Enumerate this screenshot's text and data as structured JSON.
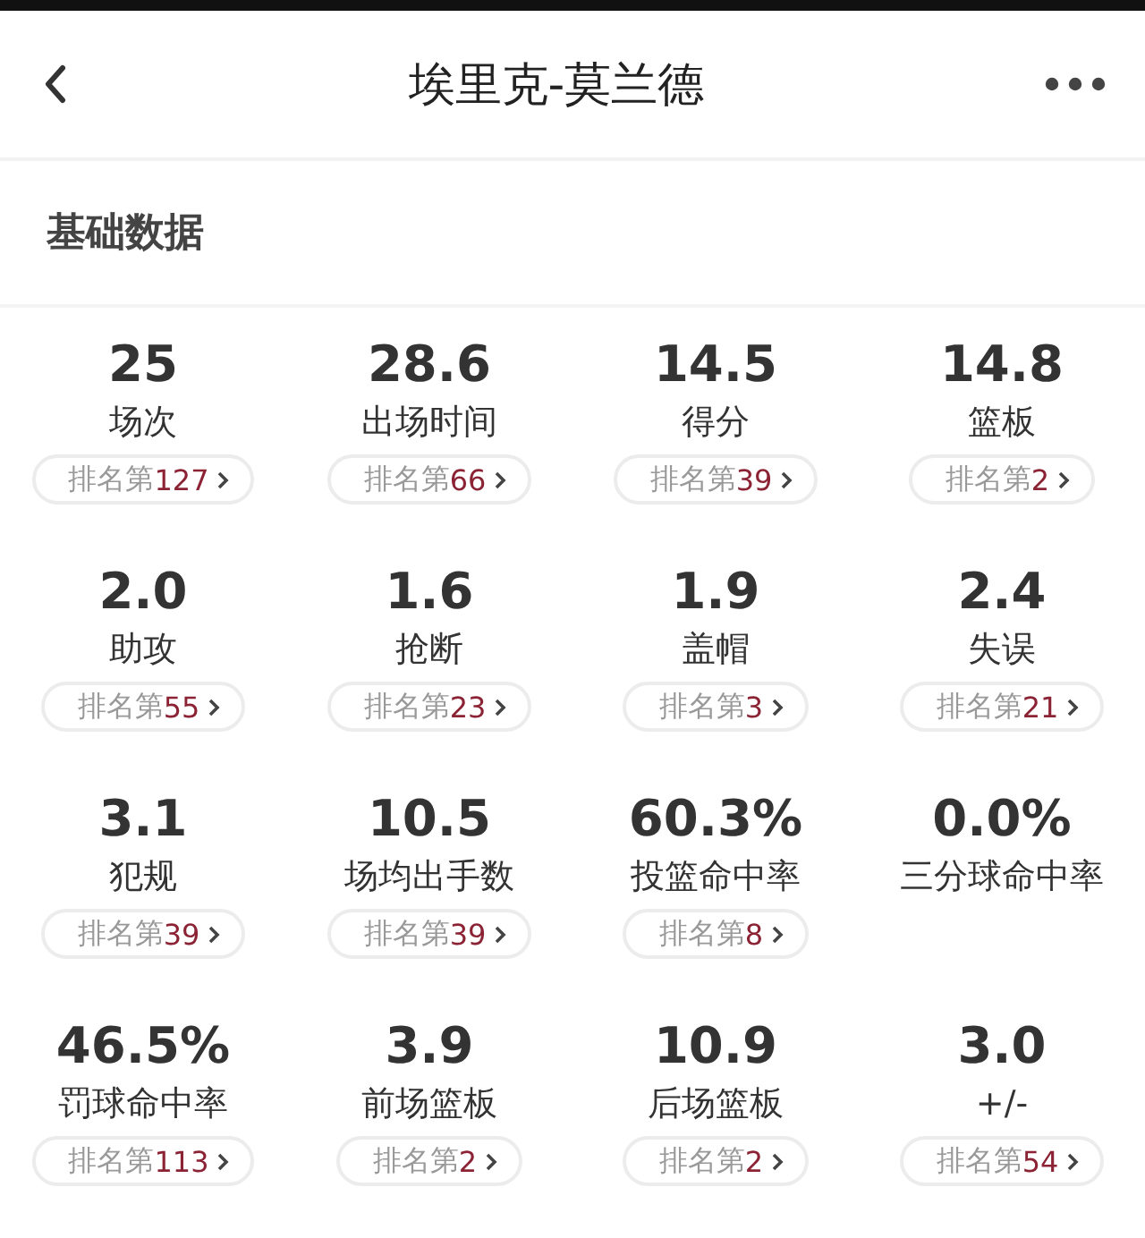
{
  "header": {
    "title": "埃里克-莫兰德"
  },
  "section": {
    "title": "基础数据"
  },
  "stats": [
    {
      "value": "25",
      "label": "场次",
      "rank_prefix": "排名第",
      "rank": "127"
    },
    {
      "value": "28.6",
      "label": "出场时间",
      "rank_prefix": "排名第",
      "rank": "66"
    },
    {
      "value": "14.5",
      "label": "得分",
      "rank_prefix": "排名第",
      "rank": "39"
    },
    {
      "value": "14.8",
      "label": "篮板",
      "rank_prefix": "排名第",
      "rank": "2"
    },
    {
      "value": "2.0",
      "label": "助攻",
      "rank_prefix": "排名第",
      "rank": "55"
    },
    {
      "value": "1.6",
      "label": "抢断",
      "rank_prefix": "排名第",
      "rank": "23"
    },
    {
      "value": "1.9",
      "label": "盖帽",
      "rank_prefix": "排名第",
      "rank": "3"
    },
    {
      "value": "2.4",
      "label": "失误",
      "rank_prefix": "排名第",
      "rank": "21"
    },
    {
      "value": "3.1",
      "label": "犯规",
      "rank_prefix": "排名第",
      "rank": "39"
    },
    {
      "value": "10.5",
      "label": "场均出手数",
      "rank_prefix": "排名第",
      "rank": "39"
    },
    {
      "value": "60.3%",
      "label": "投篮命中率",
      "rank_prefix": "排名第",
      "rank": "8"
    },
    {
      "value": "0.0%",
      "label": "三分球命中率"
    },
    {
      "value": "46.5%",
      "label": "罚球命中率",
      "rank_prefix": "排名第",
      "rank": "113"
    },
    {
      "value": "3.9",
      "label": "前场篮板",
      "rank_prefix": "排名第",
      "rank": "2"
    },
    {
      "value": "10.9",
      "label": "后场篮板",
      "rank_prefix": "排名第",
      "rank": "2"
    },
    {
      "value": "3.0",
      "label": "+/-",
      "rank_prefix": "排名第",
      "rank": "54"
    }
  ]
}
